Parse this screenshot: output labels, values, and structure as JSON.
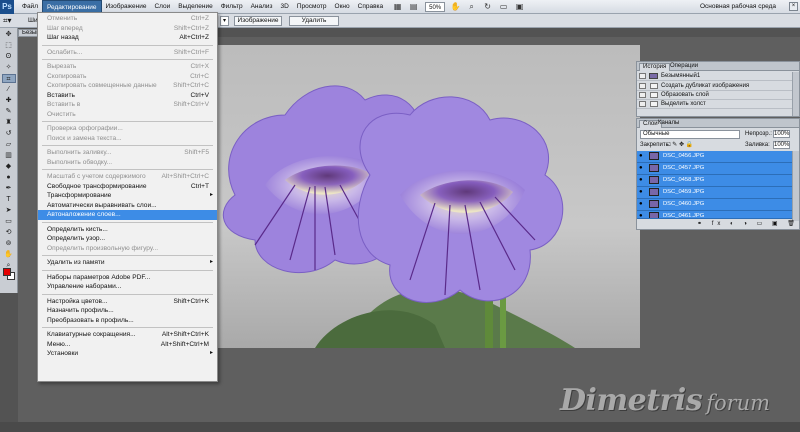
{
  "app": {
    "logo": "Ps"
  },
  "menubar": {
    "items": [
      "Файл",
      "Редактирование",
      "Изображение",
      "Слои",
      "Выделение",
      "Фильтр",
      "Анализ",
      "3D",
      "Просмотр",
      "Окно",
      "Справка"
    ],
    "active_index": 1,
    "zoom": "50%",
    "workspace": "Основная рабочая среда"
  },
  "options_bar": {
    "label": "Шир",
    "image_button": "Изображение",
    "delete_button": "Удалить"
  },
  "document": {
    "tab_title": "Безым"
  },
  "edit_menu": {
    "items": [
      {
        "label": "Отменить",
        "shortcut": "Ctrl+Z",
        "disabled": true
      },
      {
        "label": "Шаг вперед",
        "shortcut": "Shift+Ctrl+Z",
        "disabled": true
      },
      {
        "label": "Шаг назад",
        "shortcut": "Alt+Ctrl+Z",
        "disabled": false
      },
      {
        "sep": true
      },
      {
        "label": "Ослабить...",
        "shortcut": "Shift+Ctrl+F",
        "disabled": true
      },
      {
        "sep": true
      },
      {
        "label": "Вырезать",
        "shortcut": "Ctrl+X",
        "disabled": true
      },
      {
        "label": "Скопировать",
        "shortcut": "Ctrl+C",
        "disabled": true
      },
      {
        "label": "Скопировать совмещенные данные",
        "shortcut": "Shift+Ctrl+C",
        "disabled": true
      },
      {
        "label": "Вставить",
        "shortcut": "Ctrl+V",
        "disabled": false
      },
      {
        "label": "Вставить в",
        "shortcut": "Shift+Ctrl+V",
        "disabled": true
      },
      {
        "label": "Очистить",
        "shortcut": "",
        "disabled": true
      },
      {
        "sep": true
      },
      {
        "label": "Проверка орфографии...",
        "shortcut": "",
        "disabled": true
      },
      {
        "label": "Поиск и замена текста...",
        "shortcut": "",
        "disabled": true
      },
      {
        "sep": true
      },
      {
        "label": "Выполнить заливку...",
        "shortcut": "Shift+F5",
        "disabled": true
      },
      {
        "label": "Выполнить обводку...",
        "shortcut": "",
        "disabled": true
      },
      {
        "sep": true
      },
      {
        "label": "Масштаб с учетом содержимого",
        "shortcut": "Alt+Shift+Ctrl+C",
        "disabled": true
      },
      {
        "label": "Свободное трансформирование",
        "shortcut": "Ctrl+T",
        "disabled": false
      },
      {
        "label": "Трансформирование",
        "shortcut": "",
        "disabled": false,
        "submenu": true
      },
      {
        "label": "Автоматически выравнивать слои...",
        "shortcut": "",
        "disabled": false
      },
      {
        "label": "Автоналожение слоев...",
        "shortcut": "",
        "disabled": false,
        "highlighted": true
      },
      {
        "sep": true
      },
      {
        "label": "Определить кисть...",
        "shortcut": "",
        "disabled": false
      },
      {
        "label": "Определить узор...",
        "shortcut": "",
        "disabled": false
      },
      {
        "label": "Определить произвольную фигуру...",
        "shortcut": "",
        "disabled": true
      },
      {
        "sep": true
      },
      {
        "label": "Удалить из памяти",
        "shortcut": "",
        "disabled": false,
        "submenu": true
      },
      {
        "sep": true
      },
      {
        "label": "Наборы параметров Adobe PDF...",
        "shortcut": "",
        "disabled": false
      },
      {
        "label": "Управление наборами...",
        "shortcut": "",
        "disabled": false
      },
      {
        "sep": true
      },
      {
        "label": "Настройка цветов...",
        "shortcut": "Shift+Ctrl+K",
        "disabled": false
      },
      {
        "label": "Назначить профиль...",
        "shortcut": "",
        "disabled": false
      },
      {
        "label": "Преобразовать в профиль...",
        "shortcut": "",
        "disabled": false
      },
      {
        "sep": true
      },
      {
        "label": "Клавиатурные сокращения...",
        "shortcut": "Alt+Shift+Ctrl+K",
        "disabled": false
      },
      {
        "label": "Меню...",
        "shortcut": "Alt+Shift+Ctrl+M",
        "disabled": false
      },
      {
        "label": "Установки",
        "shortcut": "",
        "disabled": false,
        "submenu": true
      }
    ]
  },
  "history_panel": {
    "tabs": [
      "История",
      "Операции"
    ],
    "snapshot": "Безымянный1",
    "items": [
      "Создать дубликат изображения",
      "Образовать слой",
      "Выделить холст"
    ]
  },
  "layers_panel": {
    "tabs": [
      "Слои",
      "Каналы"
    ],
    "blend_mode": "Обычные",
    "opacity_label": "Непрозр.:",
    "opacity": "100%",
    "fill_label": "Заливка:",
    "fill": "100%",
    "lock_label": "Закрепить:",
    "layers": [
      "DSC_0456.JPG",
      "DSC_0457.JPG",
      "DSC_0458.JPG",
      "DSC_0459.JPG",
      "DSC_0460.JPG",
      "DSC_0461.JPG"
    ]
  },
  "watermark": {
    "main": "Dimetris",
    "sub": "forum"
  },
  "colors": {
    "foreground": "#e30000",
    "background": "#ffffff",
    "menu_highlight": "#3d8ce6"
  }
}
